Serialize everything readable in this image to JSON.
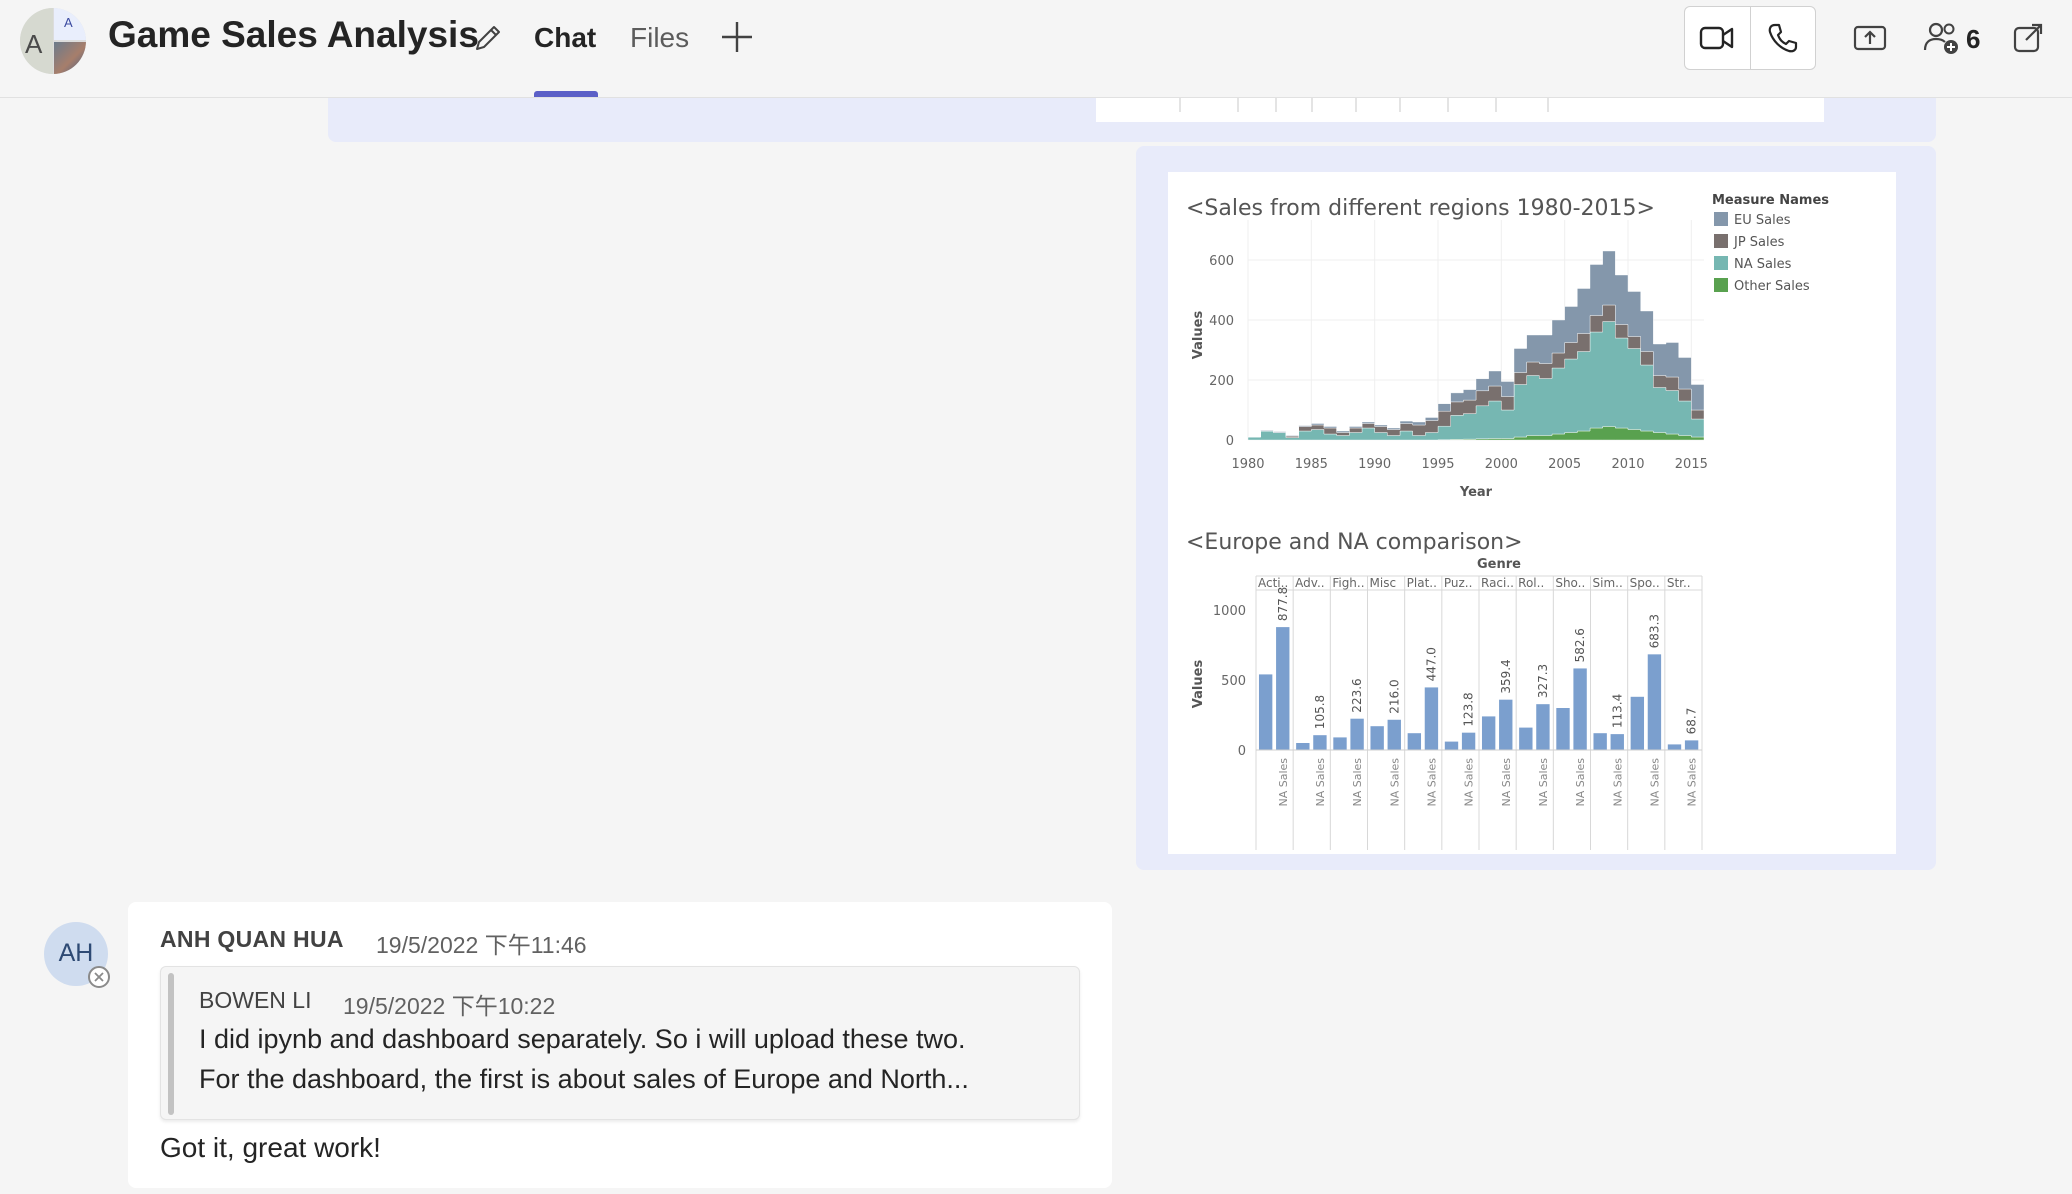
{
  "header": {
    "group_avatar": {
      "left_initial": "A",
      "top_initial": "A"
    },
    "title": "Game Sales Analysis",
    "tabs": [
      {
        "label": "Chat",
        "active": true
      },
      {
        "label": "Files",
        "active": false
      }
    ],
    "icons": [
      "edit-icon",
      "add-tab-icon",
      "video-call-icon",
      "audio-call-icon",
      "share-screen-icon",
      "participants-icon",
      "pop-out-icon"
    ],
    "participant_count": "6",
    "accent_color": "#5b5fc7"
  },
  "dashboard": {
    "chart_data": [
      {
        "type": "area",
        "title": "<Sales from different regions 1980-2015>",
        "xlabel": "Year",
        "ylabel": "Values",
        "x_ticks": [
          "1980",
          "1985",
          "1990",
          "1995",
          "2000",
          "2005",
          "2010",
          "2015"
        ],
        "y_ticks": [
          "0",
          "200",
          "400",
          "600"
        ],
        "ylim": [
          0,
          700
        ],
        "legend_title": "Measure Names",
        "legend_position": "top-right",
        "x": [
          1980,
          1981,
          1982,
          1983,
          1984,
          1985,
          1986,
          1987,
          1988,
          1989,
          1990,
          1991,
          1992,
          1993,
          1994,
          1995,
          1996,
          1997,
          1998,
          1999,
          2000,
          2001,
          2002,
          2003,
          2004,
          2005,
          2006,
          2007,
          2008,
          2009,
          2010,
          2011,
          2012,
          2013,
          2014,
          2015
        ],
        "series": [
          {
            "name": "Other Sales",
            "color": "#59a14f",
            "values": [
              0,
              0,
              0,
              0,
              0,
              0,
              0,
              0,
              0,
              0,
              0,
              0,
              0,
              0,
              0,
              1,
              2,
              3,
              4,
              5,
              5,
              10,
              15,
              15,
              20,
              25,
              30,
              40,
              45,
              40,
              35,
              30,
              25,
              20,
              15,
              10
            ]
          },
          {
            "name": "NA Sales",
            "color": "#76b7b2",
            "values": [
              10,
              30,
              25,
              8,
              30,
              35,
              20,
              15,
              25,
              40,
              25,
              15,
              30,
              15,
              25,
              45,
              80,
              85,
              110,
              125,
              95,
              175,
              200,
              190,
              220,
              245,
              265,
              320,
              350,
              300,
              270,
              220,
              150,
              145,
              115,
              60
            ]
          },
          {
            "name": "JP Sales",
            "color": "#79706e",
            "values": [
              0,
              0,
              0,
              5,
              15,
              15,
              20,
              10,
              15,
              15,
              20,
              20,
              25,
              35,
              40,
              50,
              45,
              45,
              50,
              50,
              45,
              40,
              45,
              50,
              50,
              55,
              60,
              55,
              55,
              45,
              40,
              45,
              40,
              45,
              40,
              30
            ]
          },
          {
            "name": "EU Sales",
            "color": "#8497ab",
            "values": [
              0,
              2,
              3,
              2,
              3,
              5,
              5,
              5,
              5,
              5,
              5,
              5,
              8,
              10,
              10,
              25,
              30,
              35,
              40,
              50,
              50,
              80,
              90,
              95,
              110,
              120,
              150,
              170,
              180,
              165,
              150,
              135,
              105,
              115,
              105,
              85
            ]
          }
        ]
      },
      {
        "type": "bar",
        "title": "<Europe and NA comparison>",
        "column_header": "Genre",
        "ylabel": "Values",
        "y_ticks": [
          "0",
          "500",
          "1000"
        ],
        "ylim": [
          0,
          1000
        ],
        "bar_color": "#7b9fce",
        "genres": [
          "Acti..",
          "Adv..",
          "Figh..",
          "Misc",
          "Plat..",
          "Puz..",
          "Raci..",
          "Rol..",
          "Sho..",
          "Sim..",
          "Spo..",
          "Str.."
        ],
        "bar_label": "NA Sales",
        "series": [
          {
            "values": [
              540,
              50,
              90,
              170,
              120,
              60,
              240,
              160,
              300,
              120,
              380,
              40
            ]
          },
          {
            "name": "NA Sales",
            "values": [
              877.8,
              105.8,
              223.6,
              216.0,
              447.0,
              123.8,
              359.4,
              327.3,
              582.6,
              113.4,
              683.3,
              68.7
            ],
            "value_labels": [
              "877.8",
              "105.8",
              "223.6",
              "216.0",
              "447.0",
              "123.8",
              "359.4",
              "327.3",
              "582.6",
              "113.4",
              "683.3",
              "68.7"
            ]
          }
        ]
      }
    ]
  },
  "message": {
    "avatar_initials": "AH",
    "sender": "ANH QUAN HUA",
    "timestamp": "19/5/2022 下午11:46",
    "quote": {
      "sender": "BOWEN LI",
      "timestamp": "19/5/2022 下午10:22",
      "line1": "I did ipynb and dashboard separately. So i will upload these two.",
      "line2": "For the dashboard, the first is about sales of Europe and North..."
    },
    "text": "Got it, great work!"
  }
}
